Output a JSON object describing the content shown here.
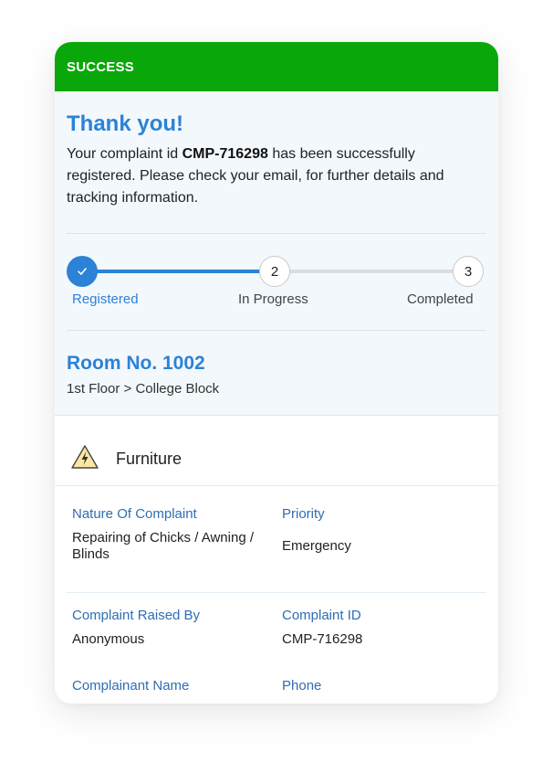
{
  "banner": {
    "label": "SUCCESS",
    "color": "#0aa70a"
  },
  "confirmation": {
    "title": "Thank you!",
    "msg_prefix": "Your complaint id ",
    "complaint_id": "CMP-716298",
    "msg_suffix": " has been successfully registered. Please check your email, for further details and tracking information."
  },
  "progress": {
    "steps": [
      {
        "label": "Registered",
        "number": "",
        "status": "done",
        "icon": "check-icon"
      },
      {
        "label": "In Progress",
        "number": "2",
        "status": "pending"
      },
      {
        "label": "Completed",
        "number": "3",
        "status": "pending"
      }
    ],
    "fill_fraction": 0.48,
    "accent": "#2b82d6"
  },
  "room": {
    "title": "Room No. 1002",
    "location": "1st Floor > College Block"
  },
  "category": {
    "label": "Furniture",
    "icon": "warning-lightning-icon"
  },
  "details": {
    "nature_label": "Nature Of Complaint",
    "nature_value": "Repairing of Chicks / Awning / Blinds",
    "priority_label": "Priority",
    "priority_value": "Emergency",
    "raised_by_label": "Complaint Raised By",
    "raised_by_value": "Anonymous",
    "complaint_id_label": "Complaint ID",
    "complaint_id_value": "CMP-716298",
    "complainant_label": "Complainant Name",
    "phone_label": "Phone"
  }
}
